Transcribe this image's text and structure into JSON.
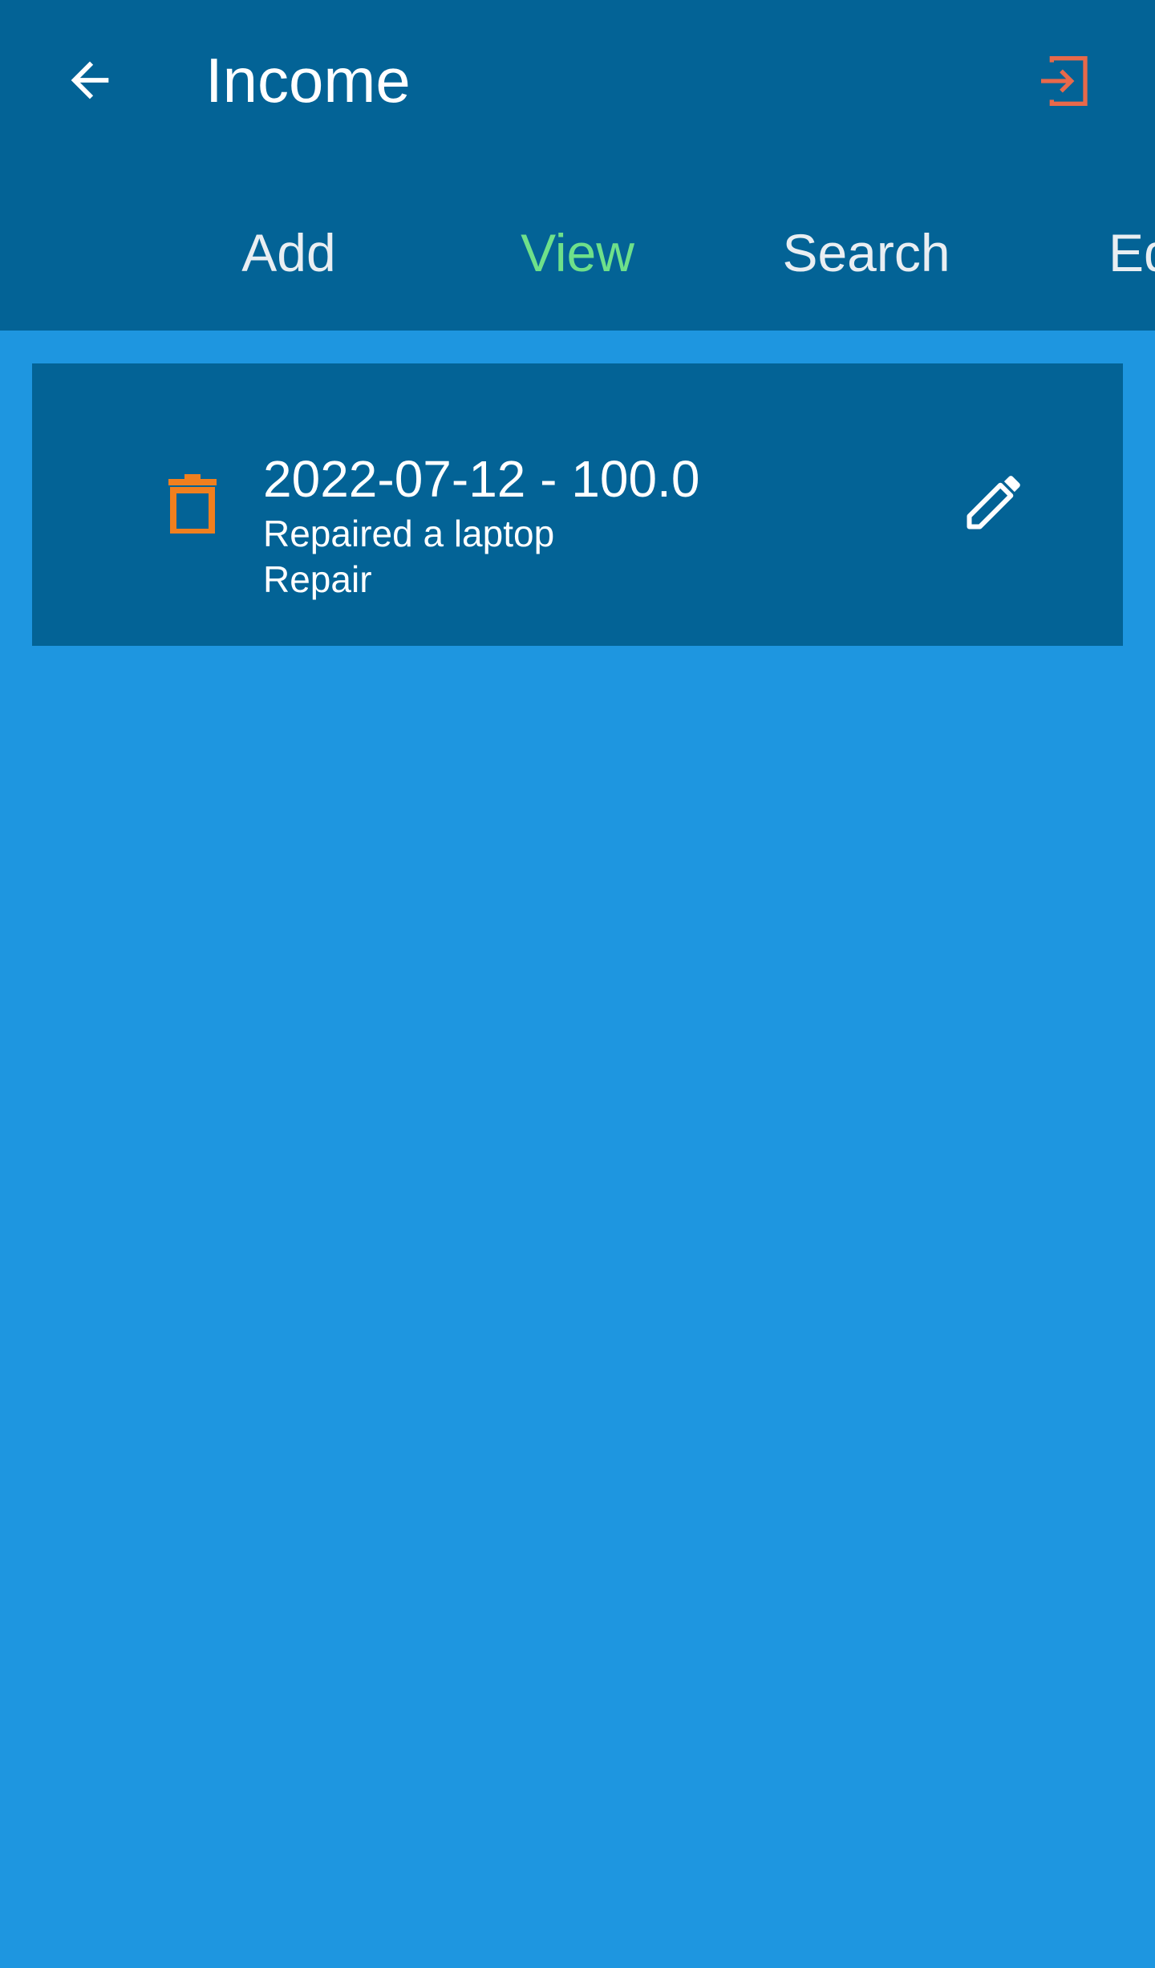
{
  "header": {
    "title": "Income",
    "back_icon": "arrow-left-icon",
    "logout_icon": "exit-to-app-icon"
  },
  "tabs": [
    {
      "label": "Add",
      "active": false
    },
    {
      "label": "View",
      "active": true
    },
    {
      "label": "Search",
      "active": false
    },
    {
      "label": "Ed",
      "active": false
    }
  ],
  "entries": [
    {
      "title": "2022-07-12 - 100.0",
      "description": "Repaired a laptop",
      "category": "Repair",
      "delete_icon": "trash-icon",
      "edit_icon": "pencil-icon"
    }
  ],
  "colors": {
    "background": "#1e96e0",
    "header": "#036396",
    "active_tab": "#6ee08a",
    "trash": "#f07f1e",
    "logout": "#e8694a"
  }
}
